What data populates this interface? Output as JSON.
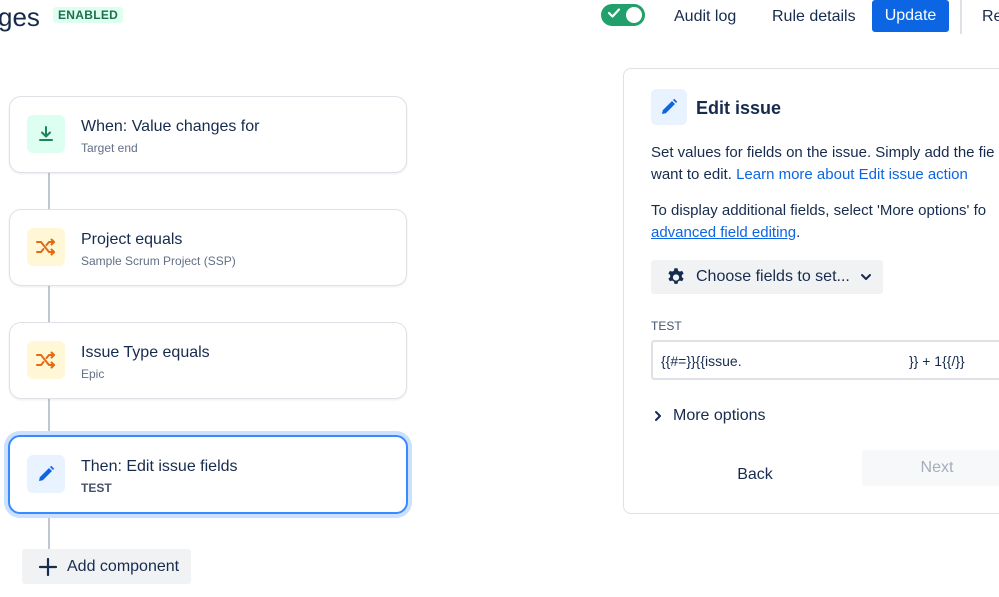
{
  "header": {
    "title": "ges",
    "status_badge": "ENABLED",
    "audit_log": "Audit log",
    "rule_details": "Rule details",
    "update": "Update",
    "partial_btn": "Re"
  },
  "flow": {
    "components": [
      {
        "title": "When: Value changes for",
        "subtitle": "Target end"
      },
      {
        "title": "Project equals",
        "subtitle": "Sample Scrum Project (SSP)"
      },
      {
        "title": "Issue Type equals",
        "subtitle": "Epic"
      },
      {
        "title": "Then: Edit issue fields",
        "subtitle": "TEST"
      }
    ],
    "add_component": "Add component"
  },
  "panel": {
    "title": "Edit issue",
    "desc_line1": "Set values for fields on the issue. Simply add the fie",
    "desc_line2_prefix": "want to edit. ",
    "desc_link": "Learn more about Edit issue action",
    "info_line1": "To display additional fields, select 'More options' fo",
    "info_link": "advanced field editing",
    "info_suffix": ".",
    "choose_fields": "Choose fields to set...",
    "field_label": "TEST",
    "field_value_start": "{{#=}}{{issue.",
    "field_value_end": "}} + 1{{/}}",
    "more_options": "More options",
    "back": "Back",
    "next": "Next"
  },
  "colors": {
    "primary": "#0c66e4",
    "toggle_on": "#22a06b",
    "selected_border": "#388bff",
    "trigger_icon": "#1f845a",
    "condition_icon": "#e56910"
  }
}
